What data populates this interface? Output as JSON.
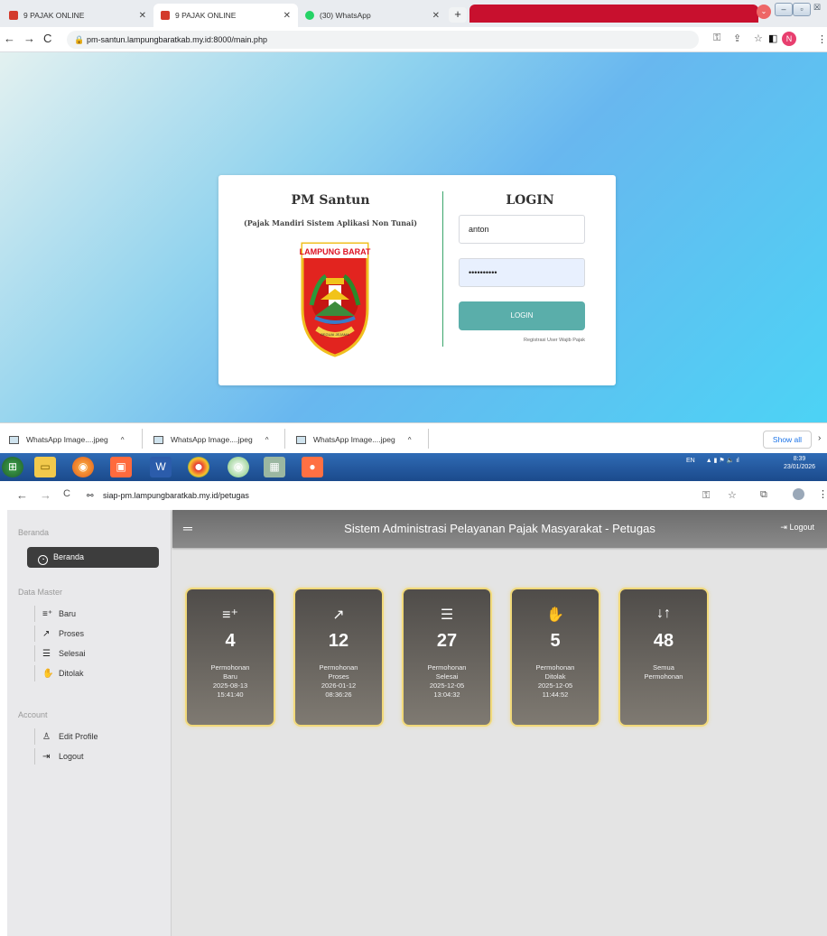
{
  "top_browser": {
    "tabs": [
      {
        "label": "9 PAJAK ONLINE"
      },
      {
        "label": "9 PAJAK ONLINE"
      },
      {
        "label": "(30) WhatsApp"
      }
    ],
    "url": "pm-santun.lampungbaratkab.my.id:8000/main.php",
    "profile_initial": "N"
  },
  "login_page": {
    "brand_title": "PM Santun",
    "brand_subtitle": "(Pajak Mandiri Sistem Aplikasi Non Tunai)",
    "logo_text": "LAMPUNG BARAT",
    "logo_motto": "BEGUAI JEJAMA",
    "login_title": "LOGIN",
    "username_value": "anton",
    "password_value": "••••••••••",
    "login_button": "LOGIN",
    "register_link": "Registrasi User Wajib Pajak"
  },
  "downloads": {
    "items": [
      {
        "label": "WhatsApp Image....jpeg"
      },
      {
        "label": "WhatsApp Image....jpeg"
      },
      {
        "label": "WhatsApp Image....jpeg"
      }
    ],
    "show_all": "Show all"
  },
  "taskbar": {
    "lang": "EN",
    "time": "8:39",
    "date": "23/01/2026"
  },
  "bottom_browser": {
    "url": "siap-pm.lampungbaratkab.my.id/petugas"
  },
  "sidebar": {
    "section_beranda": "Beranda",
    "active_item": "Beranda",
    "section_master": "Data Master",
    "master_items": [
      {
        "label": "Baru",
        "icon": "playlist-add-icon"
      },
      {
        "label": "Proses",
        "icon": "trending-up-icon"
      },
      {
        "label": "Selesai",
        "icon": "checklist-icon"
      },
      {
        "label": "Ditolak",
        "icon": "hand-stop-icon"
      }
    ],
    "section_account": "Account",
    "account_items": [
      {
        "label": "Edit Profile",
        "icon": "user-icon"
      },
      {
        "label": "Logout",
        "icon": "logout-icon"
      }
    ]
  },
  "header": {
    "title": "Sistem Administrasi Pelayanan Pajak Masyarakat - Petugas",
    "logout": "Logout"
  },
  "cards": [
    {
      "icon": "playlist-add-icon",
      "count": "4",
      "line1": "Permohonan",
      "line2": "Baru",
      "date": "2025-08-13",
      "time": "15:41:40"
    },
    {
      "icon": "trending-up-icon",
      "count": "12",
      "line1": "Permohonan",
      "line2": "Proses",
      "date": "2026-01-12",
      "time": "08:36:26"
    },
    {
      "icon": "checklist-icon",
      "count": "27",
      "line1": "Permohonan",
      "line2": "Selesai",
      "date": "2025-12-05",
      "time": "13:04:32"
    },
    {
      "icon": "hand-stop-icon",
      "count": "5",
      "line1": "Permohonan",
      "line2": "Ditolak",
      "date": "2025-12-05",
      "time": "11:44:52"
    },
    {
      "icon": "sort-arrows-icon",
      "count": "48",
      "line1": "Semua",
      "line2": "Permohonan",
      "date": "",
      "time": ""
    }
  ],
  "colors": {
    "accent_green": "#5aaeaa",
    "card_border": "#f1d97a",
    "header_bg": "#6d6d6d",
    "tab_red": "#c8102e"
  }
}
